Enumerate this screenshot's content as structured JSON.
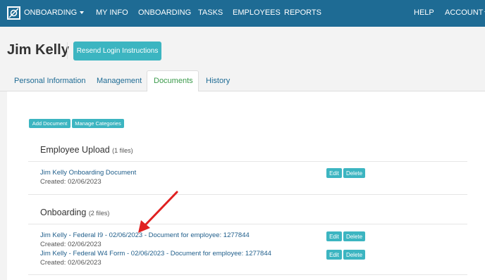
{
  "nav": {
    "brand": "ONBOARDING",
    "items": [
      "MY INFO",
      "ONBOARDING",
      "TASKS",
      "EMPLOYEES",
      "REPORTS"
    ],
    "help": "HELP",
    "account": "ACCOUNT"
  },
  "header": {
    "employee_name": "Jim Kelly",
    "resend_label": "Resend Login Instructions"
  },
  "tabs": [
    "Personal Information",
    "Management",
    "Documents",
    "History"
  ],
  "active_tab": "Documents",
  "toolbar": {
    "add_document": "Add Document",
    "manage_categories": "Manage Categories"
  },
  "sections": [
    {
      "title": "Employee Upload",
      "count": "(1 files)",
      "documents": [
        {
          "name": "Jim Kelly Onboarding Document",
          "created": "Created: 02/06/2023"
        }
      ]
    },
    {
      "title": "Onboarding",
      "count": "(2 files)",
      "documents": [
        {
          "name": "Jim Kelly - Federal I9 - 02/06/2023 - Document for employee: 1277844",
          "created": "Created: 02/06/2023"
        },
        {
          "name": "Jim Kelly - Federal W4 Form - 02/06/2023 - Document for employee: 1277844",
          "created": "Created: 02/06/2023"
        }
      ]
    }
  ],
  "actions": {
    "edit": "Edit",
    "delete": "Delete"
  },
  "colors": {
    "nav_bg": "#1e6b94",
    "accent": "#3cb5c1",
    "link": "#1e5d8a",
    "active_tab": "#3a9a4a",
    "arrow": "#e02020"
  }
}
